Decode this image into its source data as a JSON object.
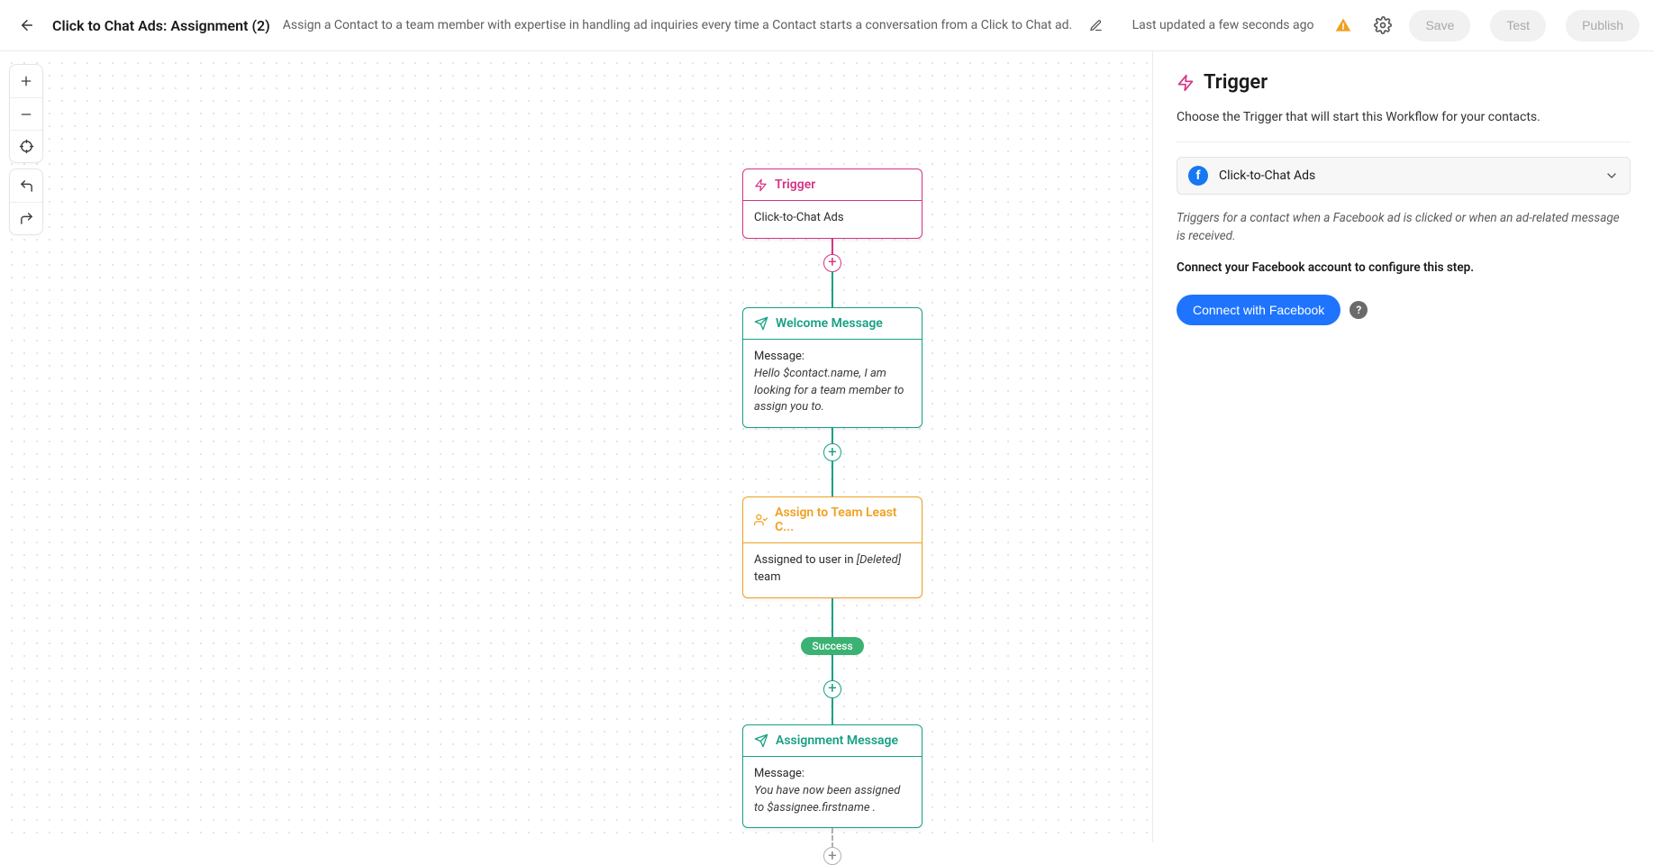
{
  "header": {
    "title": "Click to Chat Ads: Assignment (2)",
    "subtitle": "Assign a Contact to a team member with expertise in handling ad inquiries every time a Contact starts a conversation from a Click to Chat ad.",
    "last_updated": "Last updated a few seconds ago",
    "save_label": "Save",
    "test_label": "Test",
    "publish_label": "Publish"
  },
  "flow": {
    "trigger": {
      "title": "Trigger",
      "body": "Click-to-Chat Ads"
    },
    "welcome": {
      "title": "Welcome Message",
      "body_label": "Message:",
      "body_text": "Hello $contact.name, I am looking for a team member to assign you to."
    },
    "assign": {
      "title": "Assign to Team Least C...",
      "prefix": "Assigned to user in ",
      "deleted": "[Deleted]",
      "suffix": " team"
    },
    "status_label": "Success",
    "assignment_msg": {
      "title": "Assignment Message",
      "body_label": "Message:",
      "body_text": "You have now been assigned to $assignee.firstname ."
    }
  },
  "panel": {
    "title": "Trigger",
    "description": "Choose the Trigger that will start this Workflow for your contacts.",
    "select_value": "Click-to-Chat Ads",
    "hint": "Triggers for a contact when a Facebook ad is clicked or when an ad-related message is received.",
    "hint2": "Connect your Facebook account to configure this step.",
    "cta_label": "Connect with Facebook"
  }
}
